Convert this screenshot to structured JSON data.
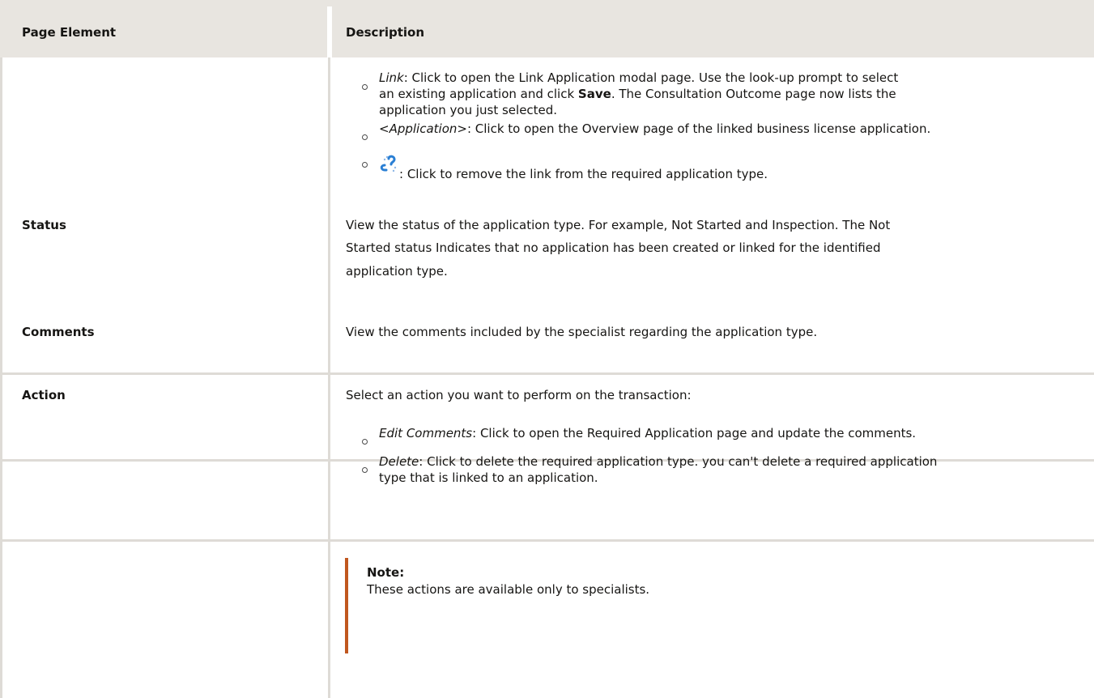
{
  "header": {
    "col1": "Page Element",
    "col2": "Description"
  },
  "row0": {
    "bullets": [
      {
        "term": "Link",
        "text_a": ": Click to open the Link Application modal page. Use the look-up prompt to select",
        "text_b_pre": "an existing application and click ",
        "text_b_bold": "Save",
        "text_b_post": ". The Consultation Outcome page now lists the",
        "text_c": "application you just selected."
      },
      {
        "term": "<Application>",
        "text": ": Click to open the Overview page of the linked business license application."
      },
      {
        "icon": "unlink-icon",
        "text": ": Click to remove the link from the required application type."
      }
    ]
  },
  "rows": [
    {
      "label": "Status",
      "lines": [
        "View the status of the application type. For example, Not Started and Inspection. The Not",
        "Started status Indicates that no application has been created or linked for the identified",
        "application type."
      ]
    },
    {
      "label": "Comments",
      "lines": [
        "View the comments included by the specialist regarding the application type."
      ]
    },
    {
      "label": "Action",
      "intro": "Select an action you want to perform on the transaction:",
      "bullets": [
        {
          "term": "Edit Comments",
          "text": ": Click to open the Required Application page and update the comments."
        },
        {
          "term": "Delete",
          "text_a": ": Click to delete the required application type. you can't delete a required application",
          "text_b": "type that is linked to an application."
        }
      ],
      "note_title": "Note:",
      "note_text": "These actions are available only to specialists."
    }
  ],
  "colors": {
    "header_bg": "#e8e5e0",
    "rule": "#dedbd6",
    "note_accent": "#c0571f",
    "icon_blue": "#2a7fd4"
  }
}
